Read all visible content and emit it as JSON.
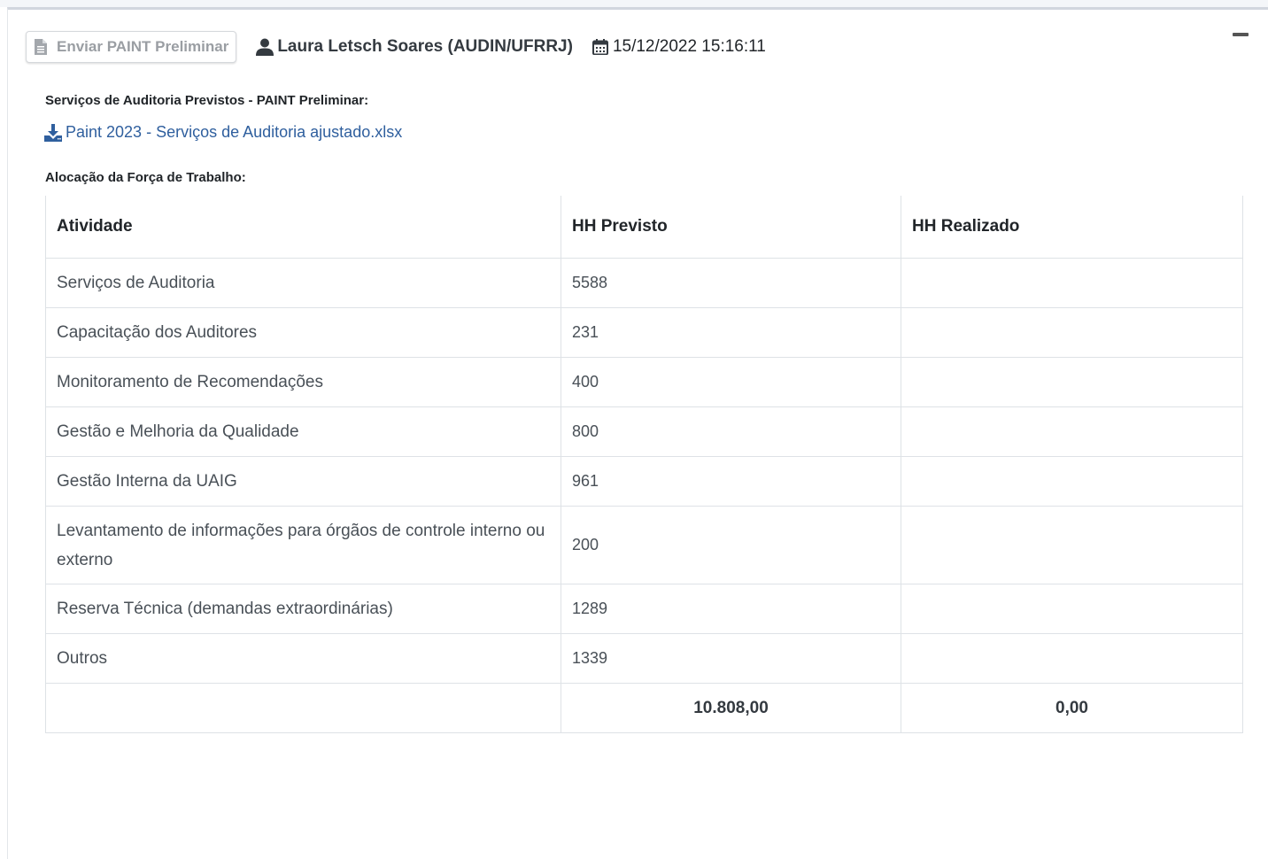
{
  "header": {
    "send_button_label": "Enviar PAINT Preliminar",
    "user_name": "Laura Letsch Soares (AUDIN/UFRRJ)",
    "datetime": "15/12/2022 15:16:11"
  },
  "audit_services": {
    "label": "Serviços de Auditoria Previstos - PAINT Preliminar:",
    "file_link": "Paint 2023 - Serviços de Auditoria ajustado.xlsx"
  },
  "workforce": {
    "label": "Alocação da Força de Trabalho:",
    "columns": [
      "Atividade",
      "HH Previsto",
      "HH Realizado"
    ],
    "rows": [
      {
        "activity": "Serviços de Auditoria",
        "planned": "5588",
        "actual": ""
      },
      {
        "activity": "Capacitação dos Auditores",
        "planned": "231",
        "actual": ""
      },
      {
        "activity": "Monitoramento de Recomendações",
        "planned": "400",
        "actual": ""
      },
      {
        "activity": "Gestão e Melhoria da Qualidade",
        "planned": "800",
        "actual": ""
      },
      {
        "activity": "Gestão Interna da UAIG",
        "planned": "961",
        "actual": ""
      },
      {
        "activity": "Levantamento de informações para órgãos de controle interno ou externo",
        "planned": "200",
        "actual": ""
      },
      {
        "activity": "Reserva Técnica (demandas extraordinárias)",
        "planned": "1289",
        "actual": ""
      },
      {
        "activity": "Outros",
        "planned": "1339",
        "actual": ""
      }
    ],
    "totals": {
      "activity": "",
      "planned": "10.808,00",
      "actual": "0,00"
    }
  },
  "icons": {
    "send_button": "file-icon",
    "user": "user-icon",
    "date": "calendar-icon",
    "download": "download-icon",
    "collapse": "minus-icon"
  },
  "colors": {
    "link": "#2f5f9e",
    "button_text_disabled": "#9a9ea3",
    "table_border": "#dee2e6"
  }
}
